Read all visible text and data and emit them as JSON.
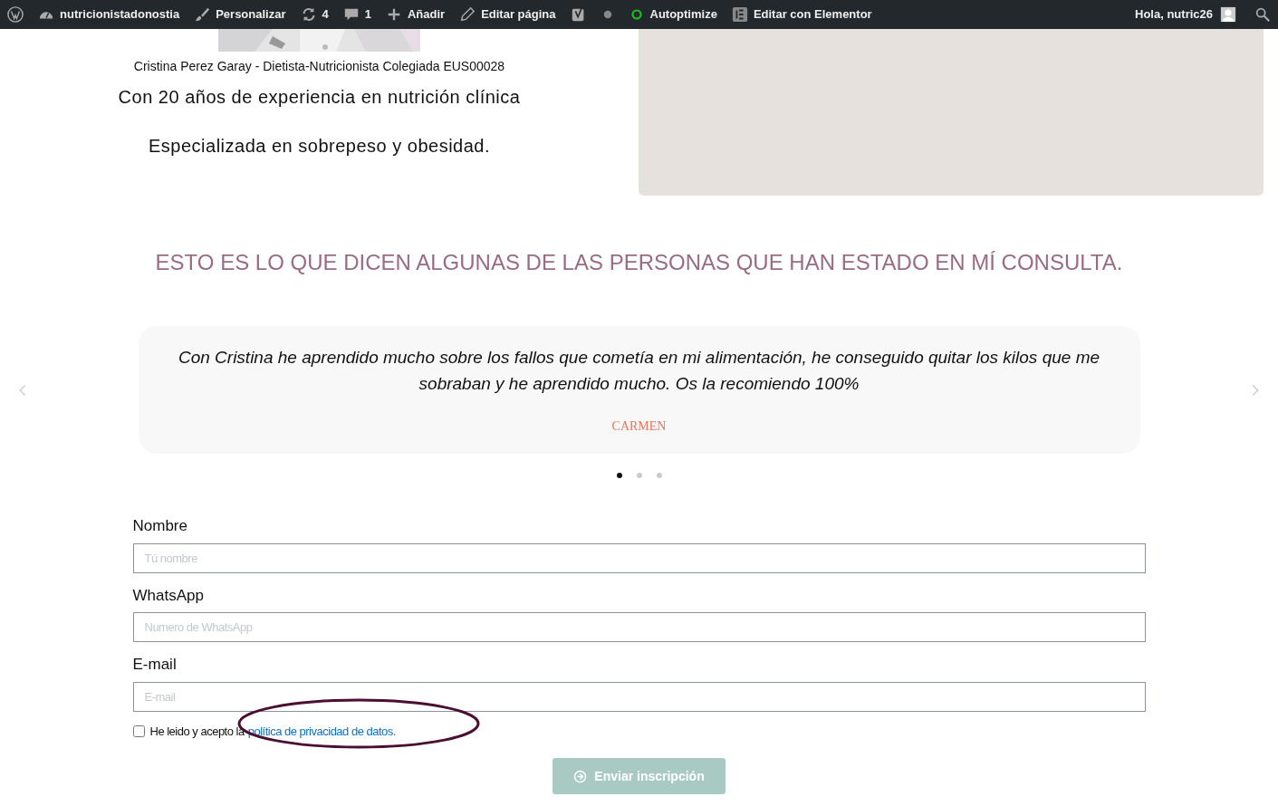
{
  "admin_bar": {
    "items": [
      {
        "kind": "wordpress"
      },
      {
        "kind": "site",
        "label": "nutricionistadonostia"
      },
      {
        "kind": "customize",
        "label": "Personalizar"
      },
      {
        "kind": "updates",
        "label": "4"
      },
      {
        "kind": "comments",
        "label": "1"
      },
      {
        "kind": "new",
        "label": "Añadir"
      },
      {
        "kind": "edit",
        "label": "Editar página"
      },
      {
        "kind": "seo"
      },
      {
        "kind": "status_dot"
      },
      {
        "kind": "optimize",
        "label": "Autoptimize"
      },
      {
        "kind": "builder",
        "label": "Editar con Elementor"
      }
    ],
    "greeting": "Hola, nutric26"
  },
  "profile": {
    "image": {
      "kind": "picture"
    },
    "caption": "Cristina Perez Garay - Dietista-Nutricionista Colegiada EUS00028",
    "lines": [
      "Con 20 años de experiencia en nutrición clínica",
      "Especializada en sobrepeso y obesidad."
    ]
  },
  "testimonials": {
    "heading": "ESTO ES LO QUE DICEN ALGUNAS DE LAS PERSONAS QUE HAN ESTADO EN MÍ CONSULTA.",
    "quote": "Con Cristina he aprendido mucho sobre los fallos que cometía en mi alimentación, he conseguido quitar los kilos que me sobraban y he aprendido mucho. Os la recomiendo 100%",
    "author": "CARMEN",
    "dots": [
      {
        "selected": true
      },
      {
        "selected": false
      },
      {
        "selected": false
      }
    ]
  },
  "form": {
    "fields": [
      {
        "label": "Nombre",
        "placeholder": "Tú nombre"
      },
      {
        "label": "WhatsApp",
        "placeholder": "Numero de WhatsApp"
      },
      {
        "label": "E-mail",
        "placeholder": "E-mail"
      }
    ],
    "consent": {
      "checked": false,
      "text": "He leido y acepto la",
      "link": "política de privacidad de datos."
    },
    "submit": "Enviar inscripción"
  },
  "annotation": {
    "kind": "ellipse"
  }
}
